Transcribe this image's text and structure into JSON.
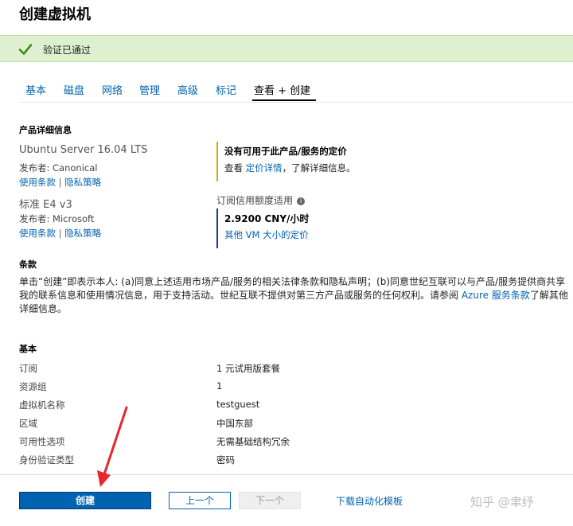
{
  "page_title": "创建虚拟机",
  "validation": {
    "text": "验证已通过"
  },
  "tabs": [
    {
      "label": "基本"
    },
    {
      "label": "磁盘"
    },
    {
      "label": "网络"
    },
    {
      "label": "管理"
    },
    {
      "label": "高级"
    },
    {
      "label": "标记"
    },
    {
      "label": "查看 + 创建",
      "active": true
    }
  ],
  "product_details": {
    "heading": "产品详细信息",
    "products": [
      {
        "name": "Ubuntu Server 16.04 LTS",
        "publisher": "发布者: Canonical",
        "terms_link": "使用条款",
        "privacy_link": "隐私策略"
      },
      {
        "name": "标准 E4 v3",
        "publisher": "发布者: Microsoft",
        "terms_link": "使用条款",
        "privacy_link": "隐私策略"
      }
    ],
    "sep": "|",
    "pricing_note": {
      "title": "没有可用于此产品/服务的定价",
      "prefix": "查看 ",
      "link": "定价详情",
      "suffix": "，了解详细信息。"
    },
    "subscription_label": "订阅信用额度适用",
    "price": "2.9200 CNY/小时",
    "other_sizes_link": "其他 VM 大小的定价"
  },
  "terms": {
    "heading": "条款",
    "text_before": "单击“创建”即表示本人: (a)同意上述适用市场产品/服务的相关法律条款和隐私声明；(b)同意世纪互联可以与产品/服务提供商共享我的联系信息和使用情况信息，用于支持活动。世纪互联不提供对第三方产品或服务的任何权利。请参阅 ",
    "link": "Azure 服务条款",
    "text_after": "了解其他详细信息。"
  },
  "basics": {
    "heading": "基本",
    "rows": [
      {
        "label": "订阅",
        "value": "1 元试用版套餐"
      },
      {
        "label": "资源组",
        "value": "1"
      },
      {
        "label": "虚拟机名称",
        "value": "testguest"
      },
      {
        "label": "区域",
        "value": "中国东部"
      },
      {
        "label": "可用性选项",
        "value": "无需基础结构冗余"
      },
      {
        "label": "身份验证类型",
        "value": "密码"
      }
    ]
  },
  "footer": {
    "create_label": "创建",
    "prev_label": "上一个",
    "next_label": "下一个",
    "download_link": "下载自动化模板"
  },
  "watermark": "知乎 @聿纾",
  "colors": {
    "link": "#0063b1",
    "create_button": "#0063b1",
    "validation_bg": "#dff0d0",
    "check": "#3c8c1e",
    "warning_bar": "#e0a800",
    "price_bar": "#1b3a8b",
    "annotation_arrow": "#e8262b"
  },
  "icons": {
    "validation": "checkmark-icon",
    "info": "info-icon"
  }
}
